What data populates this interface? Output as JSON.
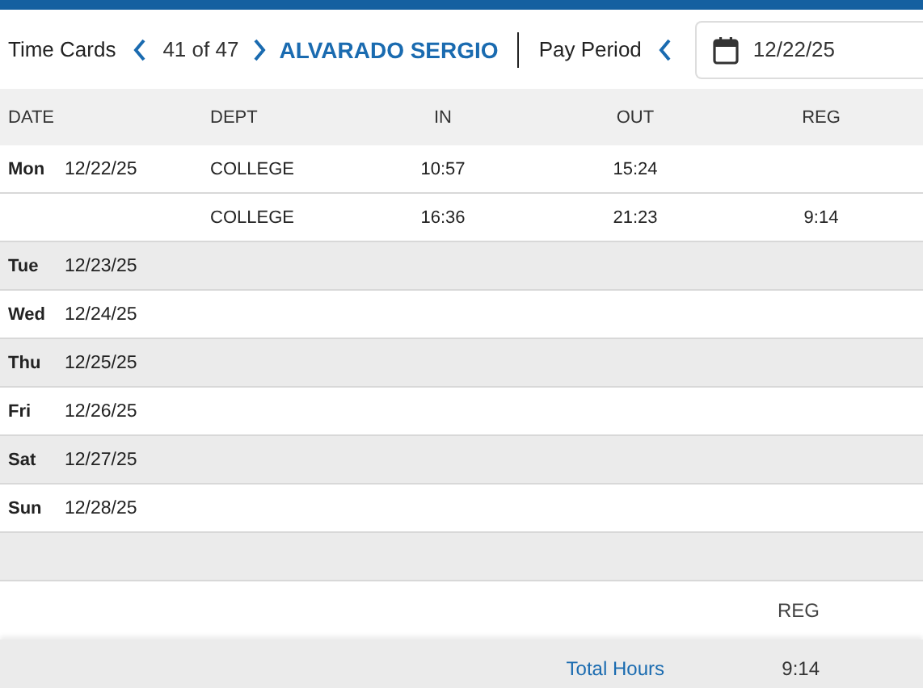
{
  "toolbar": {
    "title": "Time Cards",
    "counter": "41 of 47",
    "employee": "ALVARADO SERGIO",
    "period_label": "Pay Period",
    "period_start": "12/22/25"
  },
  "table": {
    "columns": [
      "DATE",
      "DEPT",
      "IN",
      "OUT",
      "REG"
    ],
    "rows": [
      {
        "day": "Mon",
        "date": "12/22/25",
        "dept": "COLLEGE",
        "in": "10:57",
        "out": "15:24",
        "reg": ""
      },
      {
        "day": "",
        "date": "",
        "dept": "COLLEGE",
        "in": "16:36",
        "out": "21:23",
        "reg": "9:14"
      },
      {
        "day": "Tue",
        "date": "12/23/25",
        "dept": "",
        "in": "",
        "out": "",
        "reg": ""
      },
      {
        "day": "Wed",
        "date": "12/24/25",
        "dept": "",
        "in": "",
        "out": "",
        "reg": ""
      },
      {
        "day": "Thu",
        "date": "12/25/25",
        "dept": "",
        "in": "",
        "out": "",
        "reg": ""
      },
      {
        "day": "Fri",
        "date": "12/26/25",
        "dept": "",
        "in": "",
        "out": "",
        "reg": ""
      },
      {
        "day": "Sat",
        "date": "12/27/25",
        "dept": "",
        "in": "",
        "out": "",
        "reg": ""
      },
      {
        "day": "Sun",
        "date": "12/28/25",
        "dept": "",
        "in": "",
        "out": "",
        "reg": ""
      }
    ]
  },
  "totals": {
    "column": "REG",
    "label": "Total Hours",
    "value": "9:14"
  }
}
